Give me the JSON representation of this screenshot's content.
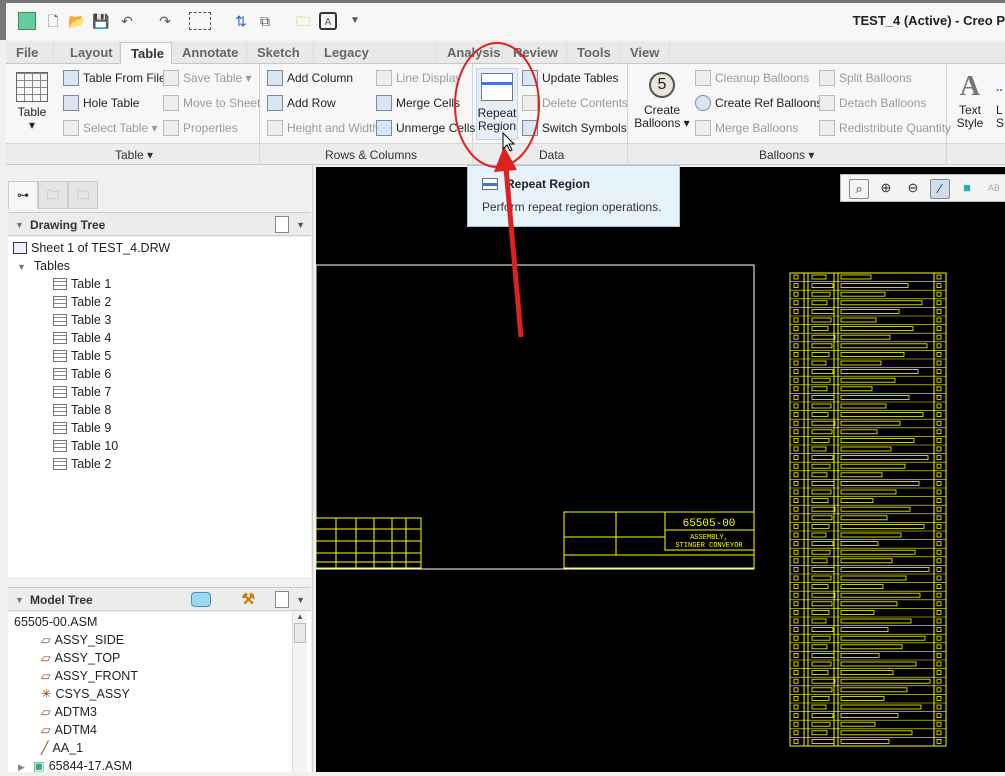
{
  "window_title": "TEST_4 (Active) - Creo P",
  "tabs": [
    "File",
    "Layout",
    "Table",
    "Annotate",
    "Sketch",
    "Legacy Migration",
    "Analysis",
    "Review",
    "Tools",
    "View"
  ],
  "active_tab": "Table",
  "ribbon": {
    "table_group": {
      "big": "Table",
      "items": [
        "Table From File",
        "Save Table",
        "Hole Table",
        "Move to Sheet",
        "Select Table",
        "Properties"
      ],
      "label": "Table"
    },
    "rows_group": {
      "items": [
        "Add Column",
        "Line Display",
        "Add Row",
        "Merge Cells",
        "Height and Width",
        "Unmerge Cells"
      ],
      "label": "Rows & Columns"
    },
    "data_group": {
      "big_line1": "Repeat",
      "big_line2": "Region",
      "items": [
        "Update Tables",
        "Delete Contents",
        "Switch Symbols"
      ],
      "label": "Data"
    },
    "balloons_group": {
      "big_line1": "Create",
      "big_line2": "Balloons",
      "items": [
        "Cleanup Balloons",
        "Split Balloons",
        "Create Ref Balloons",
        "Detach Balloons",
        "Merge Balloons",
        "Redistribute Quantity"
      ],
      "label": "Balloons"
    },
    "format_group": {
      "big_line1": "Text",
      "big_line2": "Style",
      "next_line1": "L",
      "next_line2": "S"
    }
  },
  "tooltip": {
    "title": "Repeat Region",
    "desc": "Perform repeat region operations."
  },
  "drawing_tree": {
    "title": "Drawing Tree",
    "sheet": "Sheet 1 of TEST_4.DRW",
    "folder": "Tables",
    "items": [
      "Table 1",
      "Table 2",
      "Table 3",
      "Table 4",
      "Table 5",
      "Table 6",
      "Table 7",
      "Table 8",
      "Table 9",
      "Table 10",
      "Table 2"
    ]
  },
  "model_tree": {
    "title": "Model Tree",
    "root": "65505-00.ASM",
    "items": [
      "ASSY_SIDE",
      "ASSY_TOP",
      "ASSY_FRONT",
      "CSYS_ASSY",
      "ADTM3",
      "ADTM4",
      "AA_1",
      "65844-17.ASM"
    ]
  },
  "drawing": {
    "number": "65505-00",
    "title_line1": "ASSEMBLY,",
    "title_line2": "STINGER CONVEYOR"
  },
  "colors": {
    "annotation": "#e02020",
    "drawing_lines": "#ffff40",
    "canvas": "#000000"
  }
}
